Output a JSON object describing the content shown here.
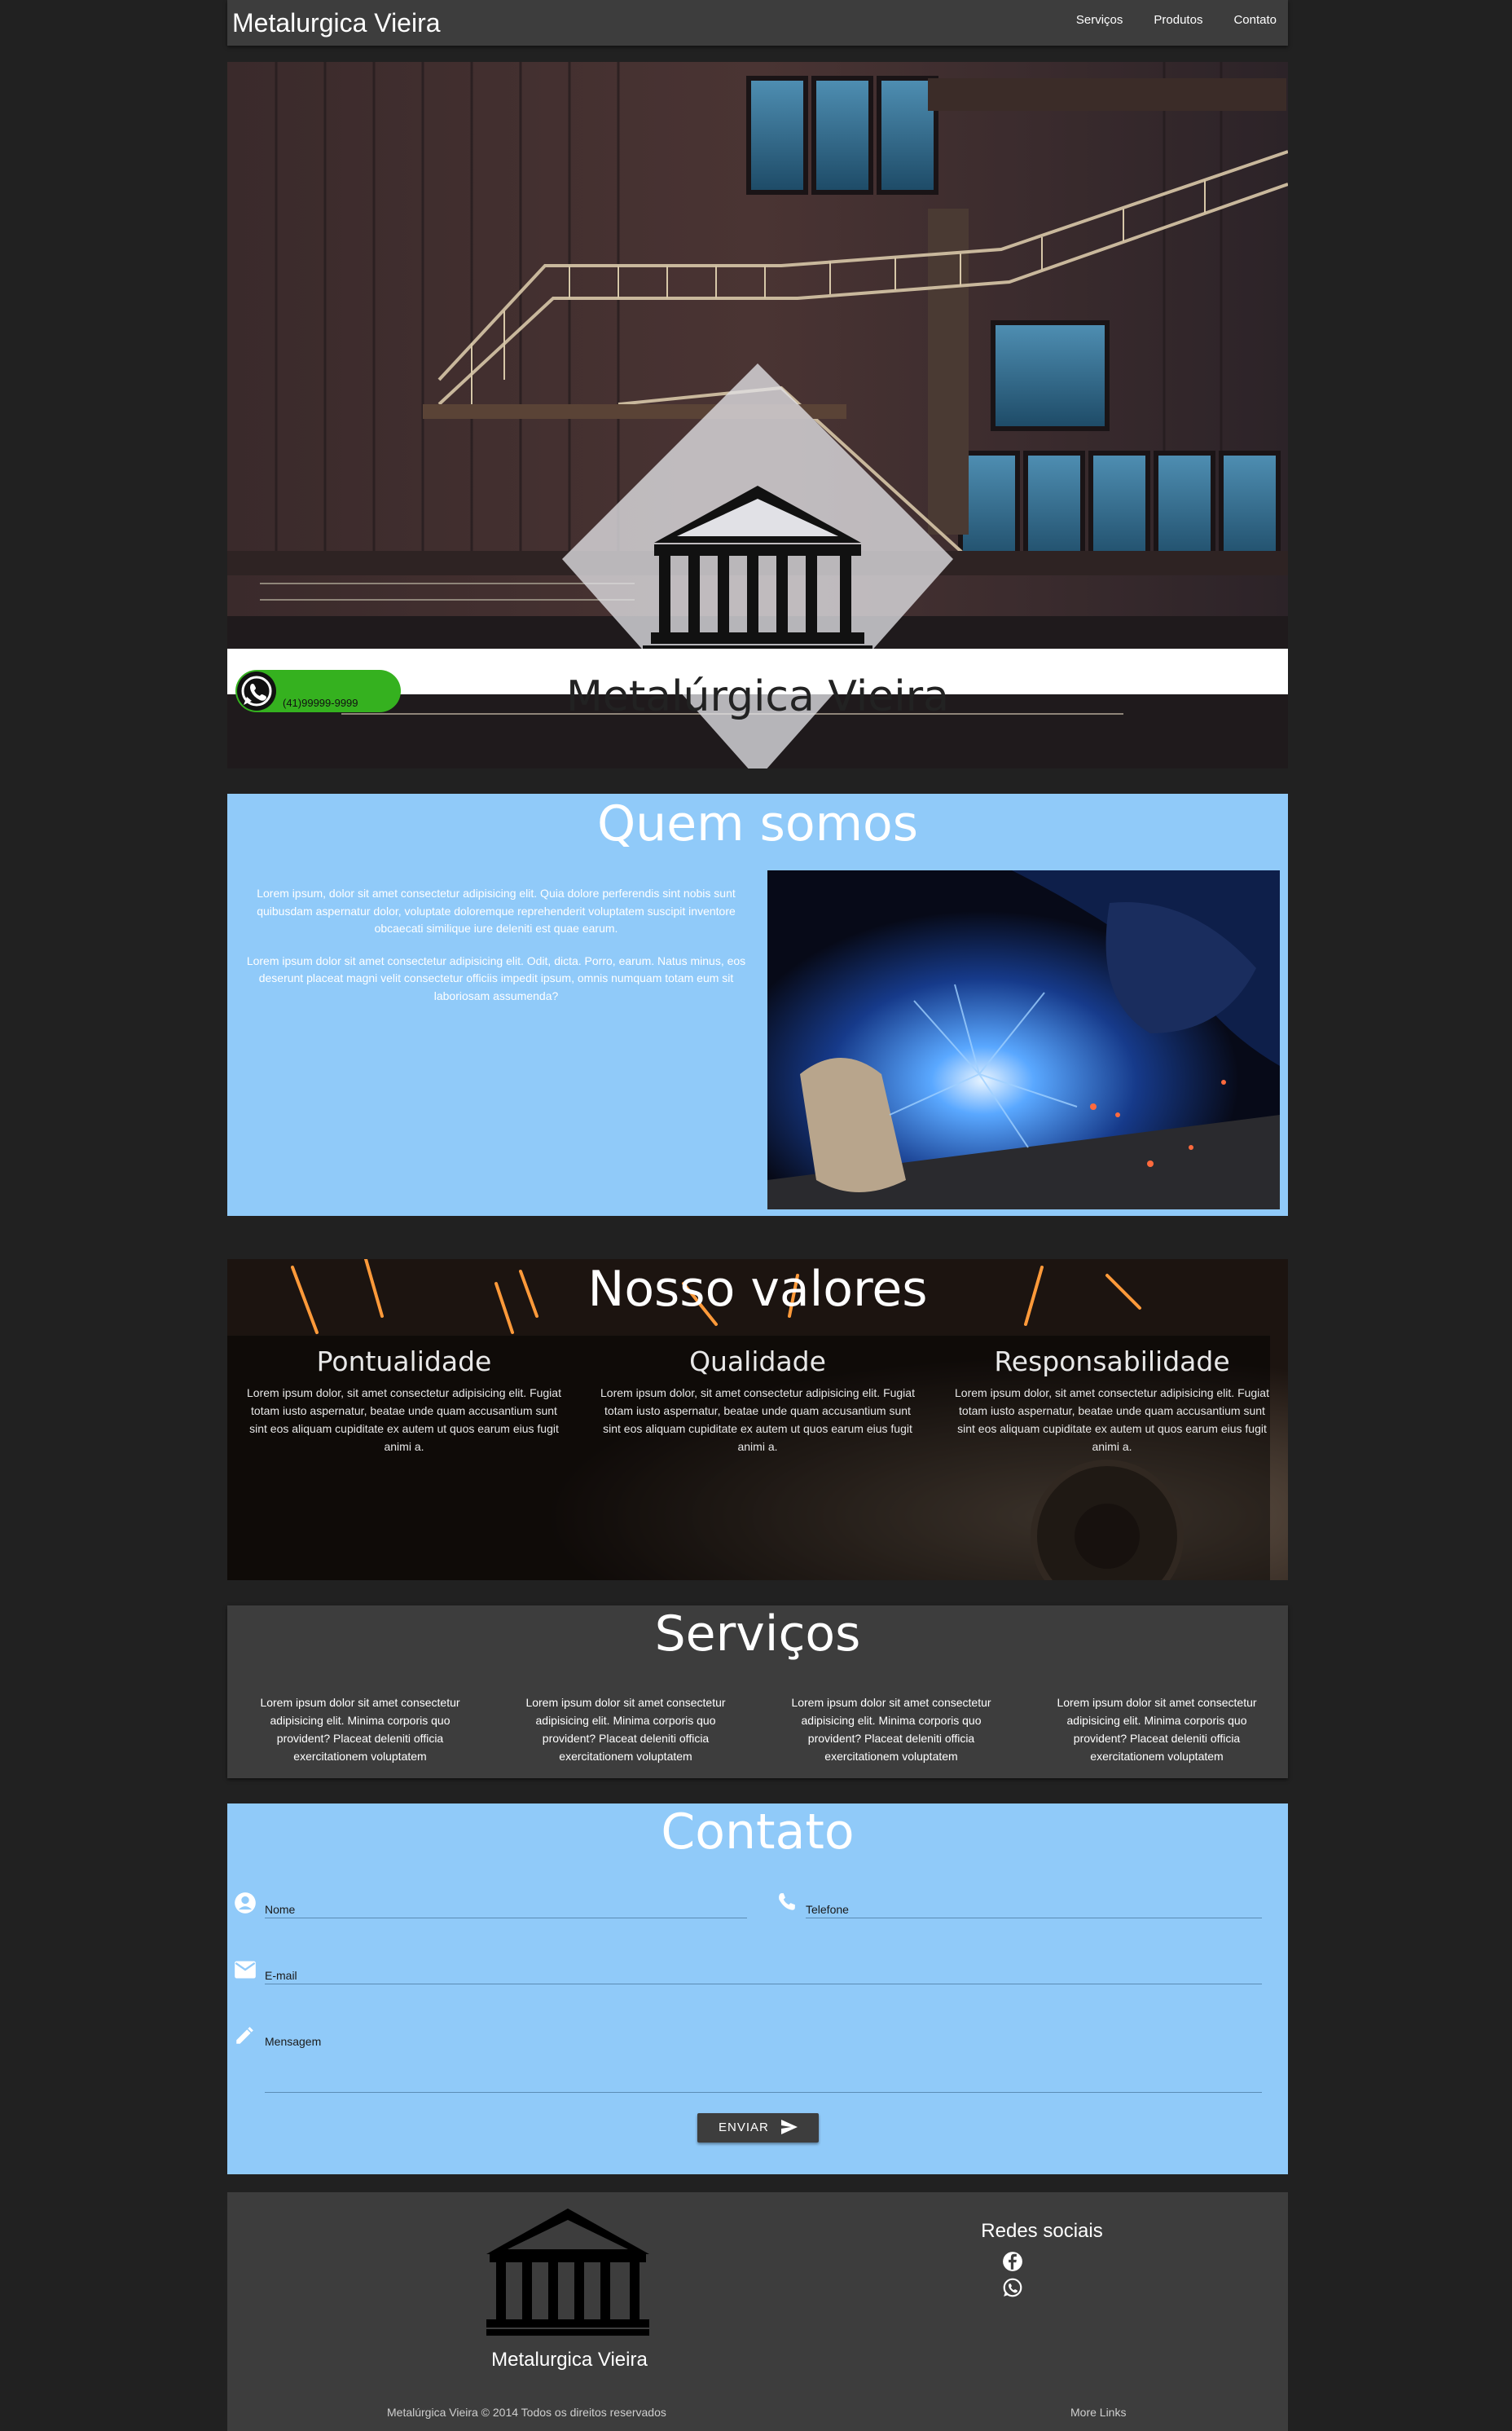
{
  "navbar": {
    "brand": "Metalurgica Vieira",
    "links": [
      "Serviços",
      "Produtos",
      "Contato"
    ]
  },
  "hero": {
    "title": "Metalúrgica Vieira",
    "whatsapp_number": "(41)99999-9999"
  },
  "about": {
    "title": "Quem somos",
    "paragraphs": [
      "Lorem ipsum, dolor sit amet consectetur adipisicing elit. Quia dolore perferendis sint nobis sunt quibusdam aspernatur dolor, voluptate doloremque reprehenderit voluptatem suscipit inventore obcaecati similique iure deleniti est quae earum.",
      "Lorem ipsum dolor sit amet consectetur adipisicing elit. Odit, dicta. Porro, earum. Natus minus, eos deserunt placeat magni velit consectetur officiis impedit ipsum, omnis numquam totam eum sit laboriosam assumenda?"
    ]
  },
  "values": {
    "title": "Nosso valores",
    "items": [
      {
        "title": "Pontualidade",
        "text": "Lorem ipsum dolor, sit amet consectetur adipisicing elit. Fugiat totam iusto aspernatur, beatae unde quam accusantium sunt sint eos aliquam cupiditate ex autem ut quos earum eius fugit animi a."
      },
      {
        "title": "Qualidade",
        "text": "Lorem ipsum dolor, sit amet consectetur adipisicing elit. Fugiat totam iusto aspernatur, beatae unde quam accusantium sunt sint eos aliquam cupiditate ex autem ut quos earum eius fugit animi a."
      },
      {
        "title": "Responsabilidade",
        "text": "Lorem ipsum dolor, sit amet consectetur adipisicing elit. Fugiat totam iusto aspernatur, beatae unde quam accusantium sunt sint eos aliquam cupiditate ex autem ut quos earum eius fugit animi a."
      }
    ]
  },
  "services": {
    "title": "Serviços",
    "items": [
      "Lorem ipsum dolor sit amet consectetur adipisicing elit. Minima corporis quo provident? Placeat deleniti officia exercitationem voluptatem",
      "Lorem ipsum dolor sit amet consectetur adipisicing elit. Minima corporis quo provident? Placeat deleniti officia exercitationem voluptatem",
      "Lorem ipsum dolor sit amet consectetur adipisicing elit. Minima corporis quo provident? Placeat deleniti officia exercitationem voluptatem",
      "Lorem ipsum dolor sit amet consectetur adipisicing elit. Minima corporis quo provident? Placeat deleniti officia exercitationem voluptatem"
    ]
  },
  "contact": {
    "title": "Contato",
    "fields": {
      "name": "Nome",
      "phone": "Telefone",
      "email": "E-mail",
      "message": "Mensagem"
    },
    "submit_label": "ENVIAR"
  },
  "footer": {
    "brand": "Metalurgica Vieira",
    "social_title": "Redes sociais",
    "copyright": "Metalúrgica Vieira © 2014 Todos os direitos reservados",
    "more_links": "More Links"
  },
  "colors": {
    "page_bg": "#212121",
    "panel_dark": "#3d3d3d",
    "accent_blue": "#90caf9",
    "whatsapp_green": "#35b11f"
  }
}
